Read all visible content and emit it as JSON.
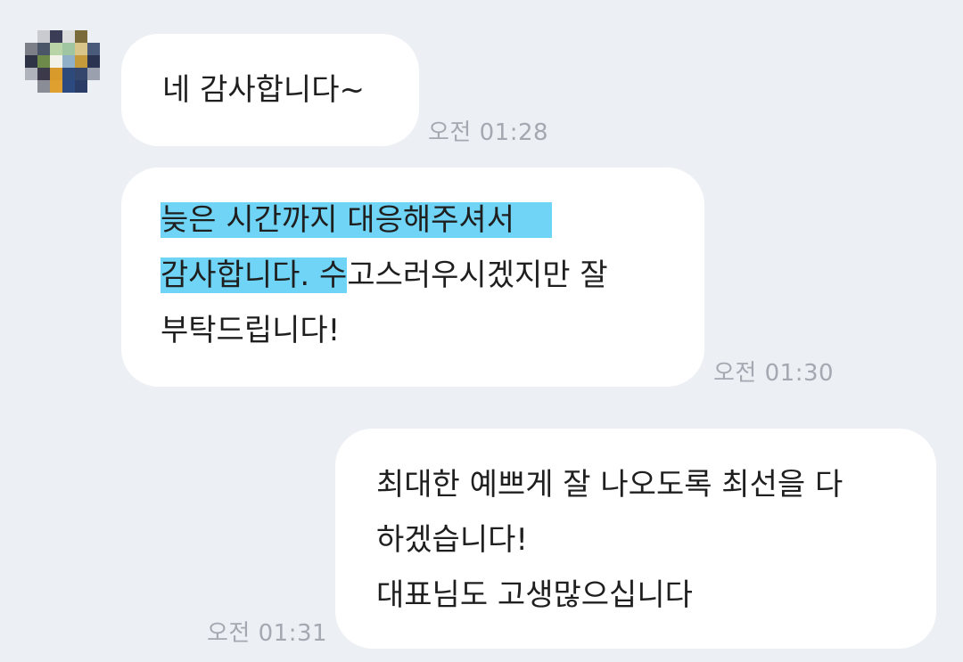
{
  "messages": [
    {
      "direction": "incoming",
      "lines": [
        "네 감사합니다~"
      ],
      "time": "오전 01:28"
    },
    {
      "direction": "incoming",
      "lines": [
        "늦은 시간까지 대응해주셔서",
        "감사합니다.",
        "수",
        "고스러우시겠지만 잘",
        "부탁드립니다!"
      ],
      "highlight_color": "#6fd4f5",
      "time": "오전 01:30"
    },
    {
      "direction": "outgoing",
      "lines": [
        "최대한 예쁘게 잘 나오도록 최선을 다",
        "하겠습니다!",
        "대표님도 고생많으십니다"
      ],
      "time": "오전 01:31"
    }
  ],
  "colors": {
    "background": "#eceff4",
    "bubble": "#ffffff",
    "text": "#1f1f1f",
    "timestamp": "#a3a8b1",
    "highlight": "#6fd4f5"
  },
  "avatar": {
    "icon": "pixelated-avatar-icon"
  }
}
